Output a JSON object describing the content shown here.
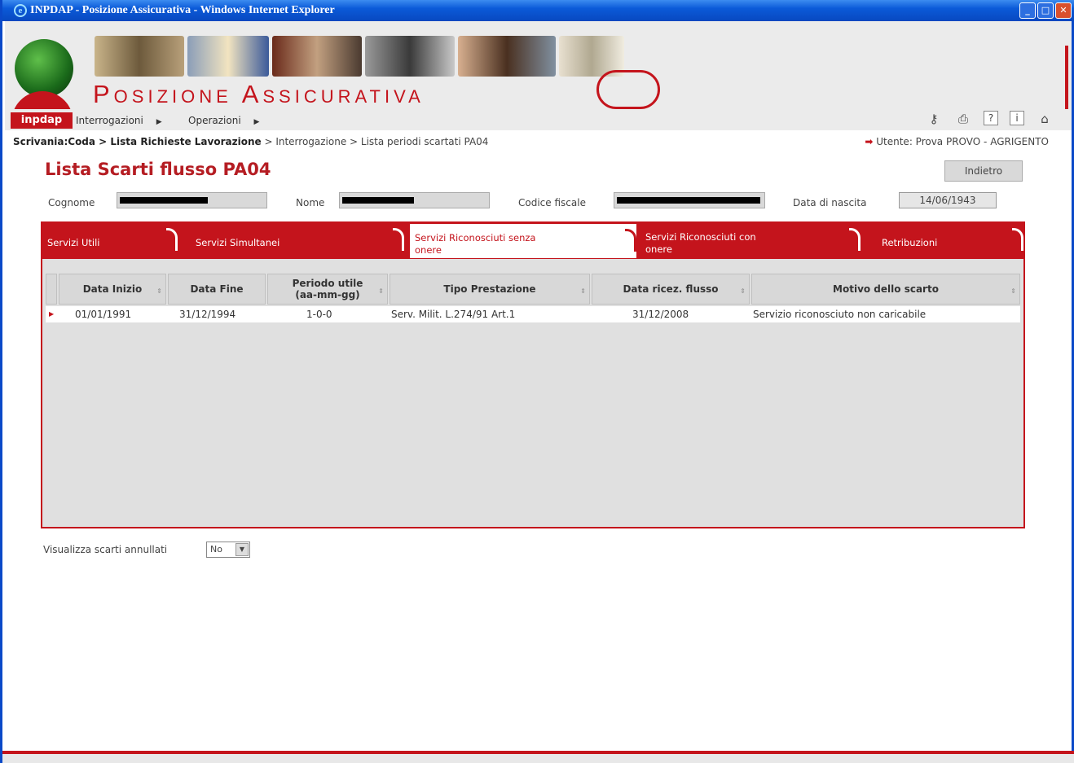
{
  "window": {
    "title": "INPDAP - Posizione Assicurativa - Windows Internet Explorer"
  },
  "header": {
    "app_title": "Posizione Assicurativa",
    "brand": "inpdap"
  },
  "menu": {
    "items": [
      {
        "label": "Interrogazioni"
      },
      {
        "label": "Operazioni"
      }
    ]
  },
  "breadcrumb": {
    "bold": "Scrivania:Coda > Lista Richieste Lavorazione",
    "rest": " > Interrogazione > Lista periodi scartati PA04"
  },
  "user": {
    "text": "Utente: Prova PROVO - AGRIGENTO"
  },
  "page": {
    "title": "Lista Scarti flusso PA04",
    "back_label": "Indietro"
  },
  "fields": {
    "cognome_label": "Cognome",
    "nome_label": "Nome",
    "cf_label": "Codice fiscale",
    "nascita_label": "Data di nascita",
    "nascita_value": "14/06/1943"
  },
  "tabs": [
    {
      "label": "Servizi Utili"
    },
    {
      "label": "Servizi Simultanei"
    },
    {
      "label": "Servizi Riconosciuti senza onere"
    },
    {
      "label": "Servizi Riconosciuti con onere"
    },
    {
      "label": "Retribuzioni"
    }
  ],
  "table": {
    "headers": [
      "Data Inizio",
      "Data Fine",
      "Periodo utile (aa-mm-gg)",
      "Tipo Prestazione",
      "Data ricez. flusso",
      "Motivo dello scarto"
    ],
    "rows": [
      [
        "01/01/1991",
        "31/12/1994",
        "1-0-0",
        "Serv. Milit. L.274/91 Art.1",
        "31/12/2008",
        "Servizio riconosciuto non caricabile"
      ]
    ]
  },
  "filter": {
    "label": "Visualizza scarti annullati",
    "value": "No"
  },
  "colors": {
    "brand_red": "#c4141c",
    "title_blue": "#0b5ad8"
  }
}
